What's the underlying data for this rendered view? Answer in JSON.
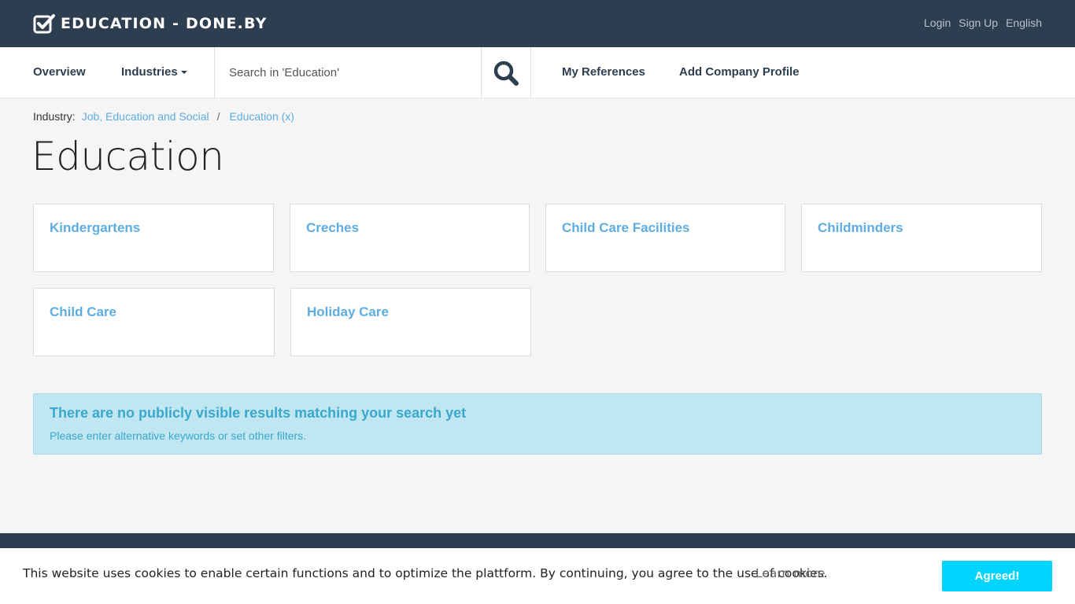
{
  "brand": {
    "name": "EDUCATION - DONE.BY"
  },
  "top_nav": {
    "login": "Login",
    "signup": "Sign Up",
    "language": "English"
  },
  "nav": {
    "overview": "Overview",
    "industries": "Industries",
    "search_placeholder": "Search in 'Education'",
    "my_references": "My References",
    "add_company_profile": "Add Company Profile"
  },
  "breadcrumb": {
    "label": "Industry:",
    "parent": "Job, Education and Social",
    "current": "Education (x)"
  },
  "page_title": "Education",
  "categories": [
    {
      "label": "Kindergartens"
    },
    {
      "label": "Creches"
    },
    {
      "label": "Child Care Facilities"
    },
    {
      "label": "Childminders"
    },
    {
      "label": "Child Care"
    },
    {
      "label": "Holiday Care"
    }
  ],
  "alert": {
    "title": "There are no publicly visible results matching your search yet",
    "message": "Please enter alternative keywords or set other filters."
  },
  "cookie": {
    "text": "This website uses cookies to enable certain functions and to optimize the plattform. By continuing, you agree to the use of cookies.",
    "learn_more": "Learn more",
    "accept": "Agreed!"
  },
  "icons": {
    "brand": "checkbox-icon",
    "search": "search-icon",
    "industries_dropdown": "caret-down-icon"
  },
  "colors": {
    "header_bg": "#2d3e50",
    "link": "#5dade2",
    "alert_bg": "#bfe6f1",
    "cookie_button": "#00d4ff"
  }
}
